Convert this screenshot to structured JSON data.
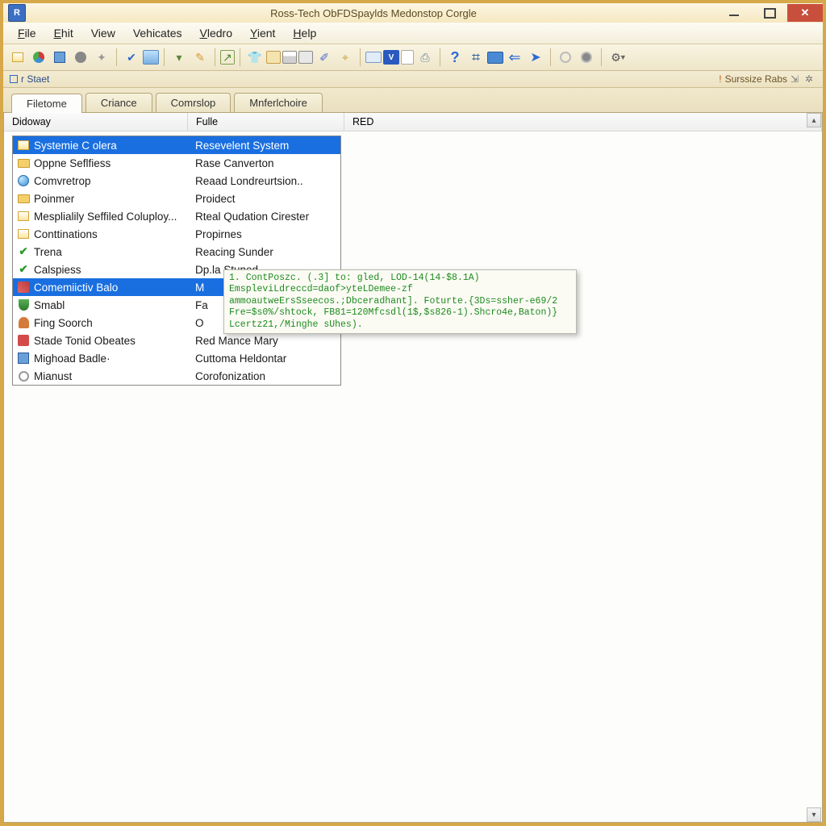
{
  "window": {
    "title": "Ross-Tech ObFDSpaylds Medonstop Corgle"
  },
  "menus": [
    "File",
    "Ehit",
    "View",
    "Vehicates",
    "Vledro",
    "Yient",
    "Help"
  ],
  "toolbar": {
    "icons": [
      "new-doc-icon",
      "pie-chart-icon",
      "chip-icon",
      "gear-wheel-icon",
      "plugin-icon",
      "sep",
      "check-icon",
      "picture-icon",
      "sep",
      "filter-icon",
      "pencil-icon",
      "sep",
      "goto-icon",
      "sep",
      "shirt-icon",
      "window-icon",
      "calendar-icon",
      "panel-icon",
      "edit-icon",
      "compass-icon",
      "sep",
      "card-icon",
      "vcds-icon",
      "doc-icon",
      "export-icon",
      "sep",
      "question-icon",
      "grid-icon",
      "monitor-icon",
      "arrow-left-icon",
      "send-icon",
      "sep",
      "record-off-icon",
      "record-on-icon",
      "sep",
      "settings-dropdown-icon"
    ]
  },
  "substatus": {
    "left_label": "r Staet",
    "right_label": "Surssize Rabs"
  },
  "tabs": [
    {
      "label": "Filetome",
      "active": true
    },
    {
      "label": "Criance",
      "active": false
    },
    {
      "label": "Comrslop",
      "active": false
    },
    {
      "label": "Mnferlchoire",
      "active": false
    }
  ],
  "columns": [
    "Didoway",
    "Fulle",
    "RED"
  ],
  "rows": [
    {
      "c1": "Systemie C olera",
      "c2": "Resevelent System",
      "icon": "page",
      "sel": true
    },
    {
      "c1": "Oppne Seflfiess",
      "c2": "Rase Canverton",
      "icon": "folder",
      "sel": false
    },
    {
      "c1": "Comvretrop",
      "c2": "Reaad Londreurtsion..",
      "icon": "globe",
      "sel": false
    },
    {
      "c1": "Poinmer",
      "c2": "Proidect",
      "icon": "folder",
      "sel": false
    },
    {
      "c1": "Mesplialily Seffiled Coluploy...",
      "c2": "Rteal Qudation Cirester",
      "icon": "page",
      "sel": false
    },
    {
      "c1": "Conttinations",
      "c2": "Propirnes",
      "icon": "page",
      "sel": false
    },
    {
      "c1": "Trena",
      "c2": "Reacing Sunder",
      "icon": "check",
      "sel": false
    },
    {
      "c1": "Calspiess",
      "c2": "Dp.la   Stuned",
      "icon": "check",
      "sel": false
    },
    {
      "c1": "Comemiictiv Balo",
      "c2": "M",
      "icon": "tool",
      "sel": true
    },
    {
      "c1": "Smabl",
      "c2": "Fa",
      "icon": "shield",
      "sel": false
    },
    {
      "c1": "Fing Soorch",
      "c2": "O",
      "icon": "person",
      "sel": false
    },
    {
      "c1": "Stade Tonid Obeates",
      "c2": "Red Mance Mary",
      "icon": "puzzle",
      "sel": false
    },
    {
      "c1": "Mighoad Badle·",
      "c2": "Cuttoma Heldontar",
      "icon": "chip",
      "sel": false
    },
    {
      "c1": "Mianust",
      "c2": "Corofonization",
      "icon": "ring",
      "sel": false
    }
  ],
  "tooltip": {
    "text": "1. ContPoszc. (.3] to: gled, LOD-14(14-$8.1A)\nEmspleviLdreccd=daof>yteLDemee-zf\nammoautweErsSseecos.;Dbceradhant]. Foturte.{3Ds=ssher-e69/2\nFre=$s0%/shtock, FB81=120Mfcsdl(1$,$s826-1).Shcro4e,Baton)}\nLcertz21,/Minghe sUhes)."
  },
  "colors": {
    "selection": "#1a6fe0",
    "tooltip_text": "#1e8a1e",
    "frame": "#d6a84a"
  }
}
